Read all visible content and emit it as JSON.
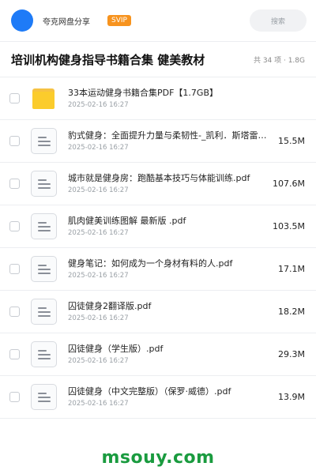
{
  "header": {
    "owner_name": "夸克网盘分享",
    "badge": "SVIP",
    "search_label": "搜索"
  },
  "share": {
    "title": "培训机构健身指导书籍合集 健美教材",
    "meta": "共 34 项 · 1.8G"
  },
  "files": [
    {
      "type": "folder",
      "name": "33本运动健身书籍合集PDF【1.7GB】",
      "date": "2025-02-16 16:27",
      "size": ""
    },
    {
      "type": "pdf",
      "name": "豹式健身：全面提升力量与柔韧性-_凯利．斯塔雷特_格伦．科多萨.pdf",
      "date": "2025-02-16 16:27",
      "size": "15.5M"
    },
    {
      "type": "pdf",
      "name": "城市就是健身房：跑酷基本技巧与体能训练.pdf",
      "date": "2025-02-16 16:27",
      "size": "107.6M"
    },
    {
      "type": "pdf",
      "name": "肌肉健美训练图解 最新版 .pdf",
      "date": "2025-02-16 16:27",
      "size": "103.5M"
    },
    {
      "type": "pdf",
      "name": "健身笔记：如何成为一个身材有料的人.pdf",
      "date": "2025-02-16 16:27",
      "size": "17.1M"
    },
    {
      "type": "pdf",
      "name": "囚徒健身2翻译版.pdf",
      "date": "2025-02-16 16:27",
      "size": "18.2M"
    },
    {
      "type": "pdf",
      "name": "囚徒健身（学生版）.pdf",
      "date": "2025-02-16 16:27",
      "size": "29.3M"
    },
    {
      "type": "pdf",
      "name": "囚徒健身（中文完整版）（保罗·威德）.pdf",
      "date": "2025-02-16 16:27",
      "size": "13.9M"
    }
  ],
  "watermark": "msouy.com",
  "colors": {
    "accent": "#1e7bf7",
    "badge": "#f7931e",
    "folder": "#fbcc2c",
    "watermark": "#1a9b3f"
  },
  "icons": {
    "folder": "folder-icon",
    "file": "document-icon"
  }
}
